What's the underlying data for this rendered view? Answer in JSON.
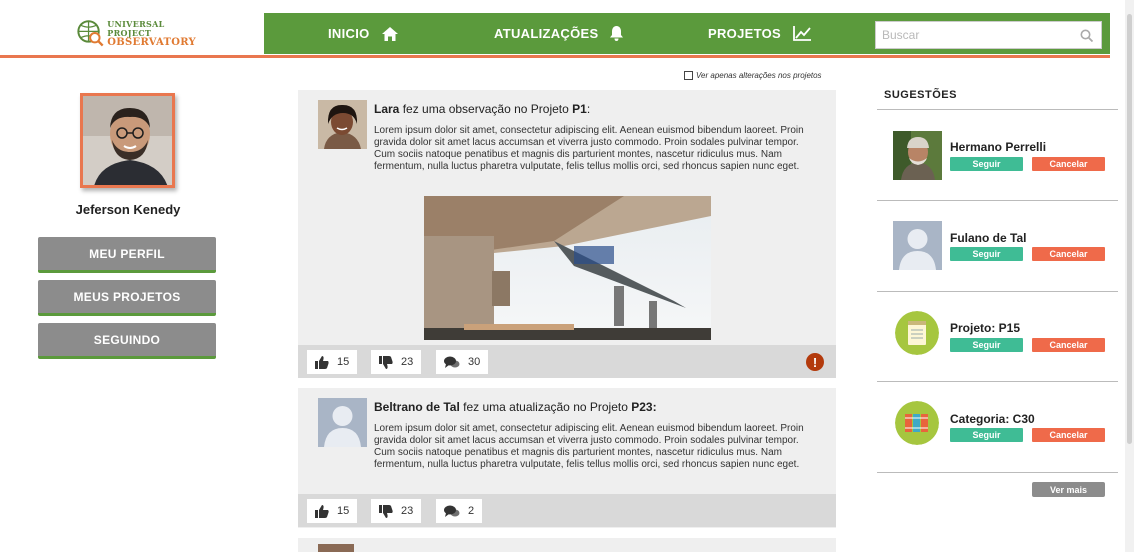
{
  "logo": {
    "line1": "UNIVERSAL",
    "line2": "PROJECT",
    "line3": "OBSERVATORY"
  },
  "nav": {
    "home": "INICIO",
    "updates": "ATUALIZAÇÕES",
    "projects": "PROJETOS"
  },
  "search": {
    "placeholder": "Buscar"
  },
  "profile": {
    "name": "Jeferson Kenedy",
    "buttons": [
      "MEU PERFIL",
      "MEUS PROJETOS",
      "SEGUINDO"
    ]
  },
  "feed": {
    "filter_label": "Ver apenas alterações nos projetos",
    "posts": [
      {
        "author": "Lara",
        "action": " fez uma observação no Projeto ",
        "project": "P1",
        "suffix": ":",
        "body": "Lorem ipsum dolor sit amet, consectetur adipiscing elit. Aenean euismod bibendum laoreet. Proin gravida dolor sit amet lacus accumsan et viverra justo commodo. Proin sodales pulvinar tempor. Cum sociis natoque penatibus et magnis dis parturient montes, nascetur ridiculus mus. Nam fermentum, nulla luctus pharetra vulputate, felis tellus mollis orci, sed rhoncus sapien nunc eget.",
        "likes": "15",
        "dislikes": "23",
        "comments": "30",
        "alert": "!"
      },
      {
        "author": "Beltrano de Tal",
        "action": " fez uma atualização no Projeto ",
        "project": "P23",
        "suffix": ":",
        "body": "Lorem ipsum dolor sit amet, consectetur adipiscing elit. Aenean euismod bibendum laoreet. Proin gravida dolor sit amet lacus accumsan et viverra justo commodo. Proin sodales pulvinar tempor. Cum sociis natoque penatibus et magnis dis parturient montes, nascetur ridiculus mus. Nam fermentum, nulla luctus pharetra vulputate, felis tellus mollis orci, sed rhoncus sapien nunc eget.",
        "likes": "15",
        "dislikes": "23",
        "comments": "2"
      }
    ]
  },
  "suggestions": {
    "title": "SUGESTÕES",
    "follow_label": "Seguir",
    "cancel_label": "Cancelar",
    "items": [
      {
        "name": "Hermano Perrelli"
      },
      {
        "name": "Fulano de Tal"
      },
      {
        "name": "Projeto: P15"
      },
      {
        "name": "Categoria: C30"
      }
    ],
    "more_label": "Ver mais"
  },
  "colors": {
    "nav_green": "#5b9a3c",
    "accent_orange": "#e9774f",
    "follow_teal": "#3fbc95",
    "cancel_red": "#ef6a4a",
    "alert_red": "#b33a0c"
  }
}
